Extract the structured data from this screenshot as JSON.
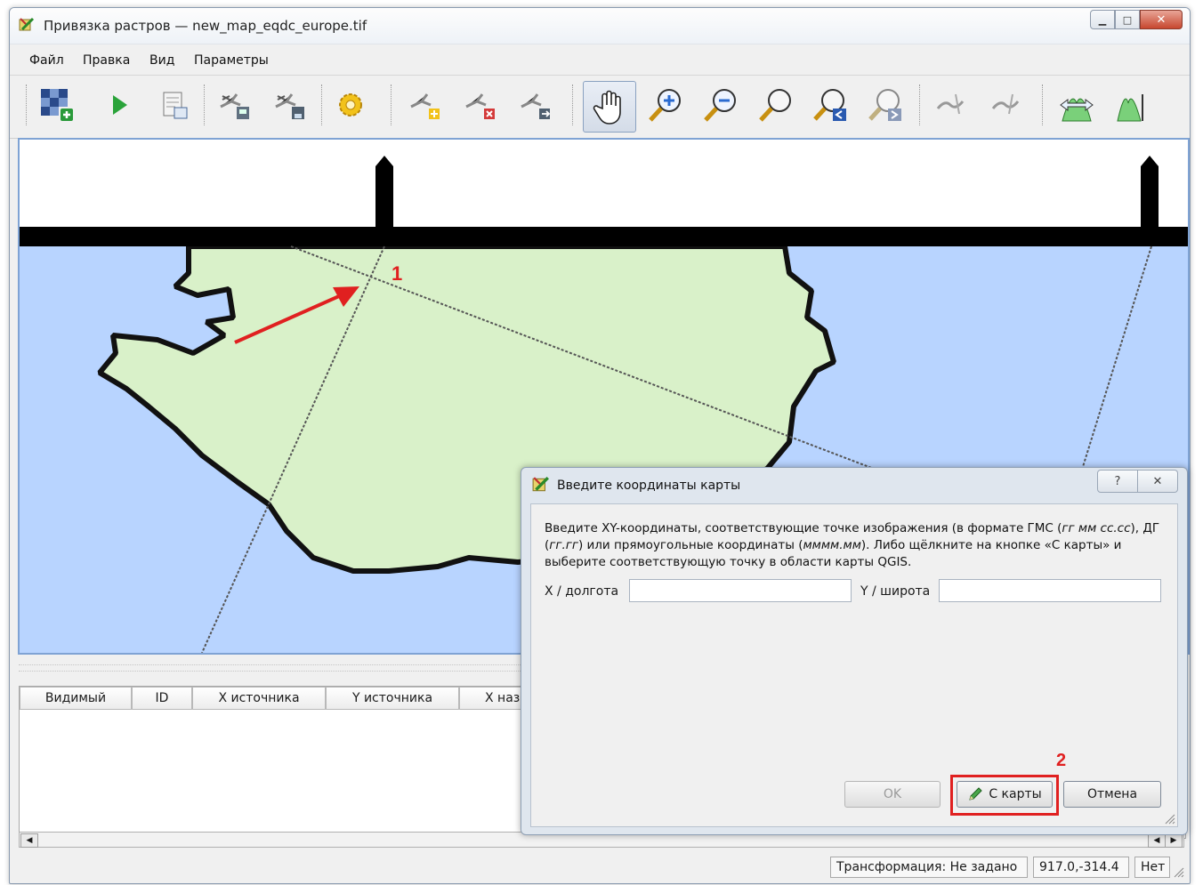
{
  "window": {
    "title": "Привязка растров — new_map_eqdc_europe.tif"
  },
  "menu": {
    "items": [
      "Файл",
      "Правка",
      "Вид",
      "Параметры"
    ]
  },
  "toolbar": {
    "icons": [
      "open-raster-icon",
      "start-georeferencing-icon",
      "generate-gdal-script-icon",
      "load-gcp-points-icon",
      "save-gcp-points-icon",
      "transformation-settings-icon",
      "add-point-icon",
      "delete-point-icon",
      "move-gcp-point-icon",
      "pan-icon",
      "zoom-in-icon",
      "zoom-out-icon",
      "zoom-to-layer-icon",
      "zoom-last-icon",
      "zoom-next-icon",
      "link-georeferencer-to-qgis-icon",
      "link-qgis-to-georeferencer-icon",
      "full-histogram-stretch-icon",
      "local-histogram-stretch-icon"
    ]
  },
  "annotations": {
    "marker1": "1",
    "marker2": "2"
  },
  "table": {
    "columns": [
      "Видимый",
      "ID",
      "X источника",
      "Y источника",
      "X назн"
    ]
  },
  "status": {
    "transform": "Трансформация: Не задано",
    "coords": "917.0,-314.4",
    "crs": "Нет"
  },
  "dialog": {
    "title": "Введите координаты карты",
    "help_btn": "?",
    "close_btn": "✕",
    "description_1": "Введите XY-координаты, соответствующие точке изображения (в формате ГМС (",
    "description_fmt1": "гг мм сс.сс",
    "description_2": "), ДГ (",
    "description_fmt2": "гг.гг",
    "description_3": ") или прямоугольные координаты (",
    "description_fmt3": "мммм.мм",
    "description_4": "). Либо щёлкните на кнопке «С карты» и выберите соответствующую точку в области карты QGIS.",
    "x_label": "X / долгота",
    "y_label": "Y / широта",
    "x_value": "",
    "y_value": "",
    "ok": "OK",
    "from_map": "С карты",
    "cancel": "Отмена"
  },
  "colors": {
    "land": "#d9f1c9",
    "sea": "#b8d4ff",
    "border": "#111111",
    "annotation": "#e02020"
  }
}
